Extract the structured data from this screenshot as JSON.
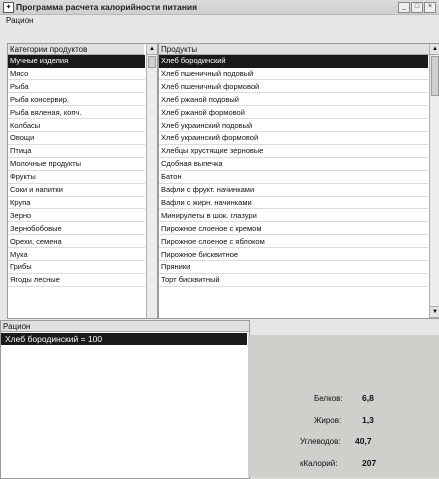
{
  "window": {
    "title": "Программа расчета калорийности питания",
    "icon": "app-icon"
  },
  "menu": {
    "items": [
      "Рацион"
    ]
  },
  "categories": {
    "header": "Категории продуктов",
    "selected_index": 0,
    "items": [
      "Мучные изделия",
      "Мясо",
      "Рыба",
      "Рыба консервир.",
      "Рыба вяленая, копч.",
      "Колбасы",
      "Овощи",
      "Птица",
      "Молочные продукты",
      "Фрукты",
      "Соки и напитки",
      "Крупа",
      "Зерно",
      "Зернобобовые",
      "Орехи, семена",
      "Мука",
      "Грибы",
      "Ягоды лесные"
    ]
  },
  "products": {
    "header": "Продукты",
    "selected_index": 0,
    "items": [
      "Хлеб бородинский",
      "Хлеб пшеничный подовый",
      "Хлеб пшеничный формовой",
      "Хлеб ржаной подовый",
      "Хлеб ржаной формовой",
      "Хлеб украинский подовый",
      "Хлеб украинский формовой",
      "Хлебцы хрустящие зерновые",
      "Сдобная выпечка",
      "Батон",
      "Вафли с фрукт. начинками",
      "Вафли с жирн. начинками",
      "Минирулеты в шок. глазури",
      "Пирожное слоеное с кремом",
      "Пирожное слоеное с яблоком",
      "Пирожное бисквитное",
      "Пряники",
      "Торт бисквитный"
    ]
  },
  "ration": {
    "header": "Рацион",
    "items": [
      "Хлеб бородинский = 100"
    ]
  },
  "nutrition": {
    "rows": [
      {
        "label": "Белков:",
        "value": "6,8"
      },
      {
        "label": "Жиров:",
        "value": "1,3"
      },
      {
        "label": "Углеводов:",
        "value": "40,7"
      },
      {
        "label": "кКалорий:",
        "value": "207"
      }
    ]
  }
}
